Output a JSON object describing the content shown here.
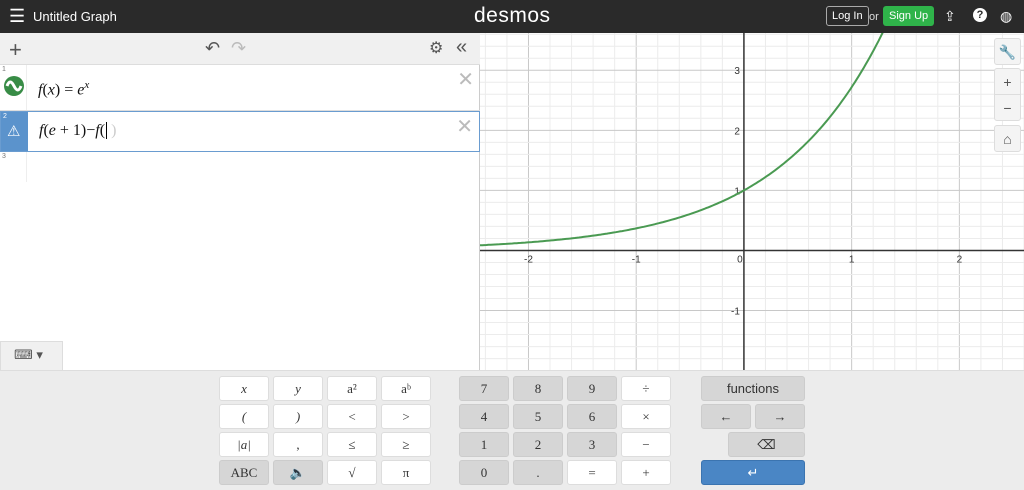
{
  "header": {
    "title": "Untitled Graph",
    "logo": "desmos",
    "login": "Log In",
    "or": "or",
    "signup": "Sign Up"
  },
  "expressions": [
    {
      "index": "1",
      "latex": "f(x) = e^x",
      "parts": [
        "f",
        "(",
        "x",
        ")",
        " = ",
        "e",
        "x"
      ],
      "color": "#388c46",
      "icon": "sine-wave-icon"
    },
    {
      "index": "2",
      "latex": "f(e+1)−f(",
      "parts": [
        "f",
        "(",
        "e",
        " + ",
        "1",
        ")",
        "−",
        "f",
        "("
      ],
      "icon": "warning-icon"
    },
    {
      "index": "3"
    }
  ],
  "graph": {
    "x_ticks": [
      "-2",
      "-1",
      "0",
      "1",
      "2"
    ],
    "y_ticks": [
      "3",
      "2",
      "1",
      "-1"
    ],
    "xrange": [
      -2.45,
      2.6
    ],
    "yrange": [
      -1.99,
      3.62
    ],
    "curve": "e^x",
    "curve_color": "#4a9a52"
  },
  "keypad": {
    "left": [
      [
        "x",
        "y",
        "a²",
        "aᵇ"
      ],
      [
        "(",
        ")",
        "<",
        ">"
      ],
      [
        "|a|",
        ",",
        "≤",
        "≥"
      ],
      [
        "ABC",
        "🔈",
        "√",
        "π"
      ]
    ],
    "mid": [
      [
        "7",
        "8",
        "9",
        "÷"
      ],
      [
        "4",
        "5",
        "6",
        "×"
      ],
      [
        "1",
        "2",
        "3",
        "−"
      ],
      [
        "0",
        ".",
        "=",
        "+"
      ]
    ],
    "functions": "functions",
    "left_arrow": "←",
    "right_arrow": "→",
    "backspace": "⌫",
    "enter": "↵"
  }
}
